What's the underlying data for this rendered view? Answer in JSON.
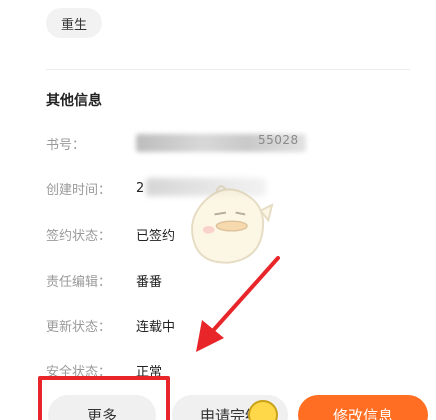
{
  "tag": {
    "label": "重生"
  },
  "section": {
    "title": "其他信息"
  },
  "rows": [
    {
      "label": "书号：",
      "value": ""
    },
    {
      "label": "创建时间：",
      "value": "2"
    },
    {
      "label": "签约状态：",
      "value": "已签约"
    },
    {
      "label": "责任编辑：",
      "value": "番番"
    },
    {
      "label": "更新状态：",
      "value": "连载中"
    },
    {
      "label": "安全状态：",
      "value": "正常"
    }
  ],
  "book_id_tail": "55028",
  "buttons": {
    "more": "更多",
    "apply": "申请完结",
    "edit": "修改信息"
  },
  "colors": {
    "primary": "#ff6e22",
    "annotation": "#e8262a"
  },
  "icons": {
    "mascot": "chick-mascot-icon",
    "emoji": "smiley-emoji-icon",
    "annotation": "arrow-annotation"
  }
}
